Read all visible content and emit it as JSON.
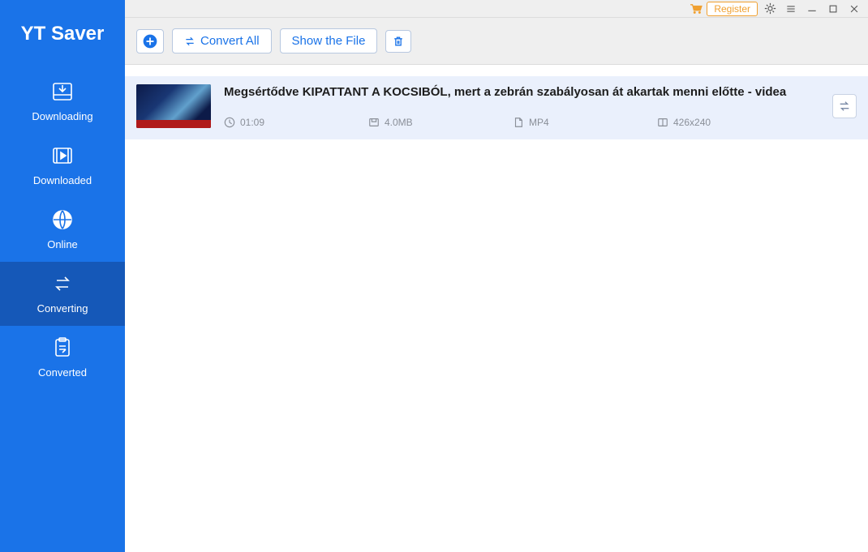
{
  "app": {
    "title": "YT Saver"
  },
  "sidebar": {
    "items": [
      {
        "label": "Downloading"
      },
      {
        "label": "Downloaded"
      },
      {
        "label": "Online"
      },
      {
        "label": "Converting"
      },
      {
        "label": "Converted"
      }
    ]
  },
  "titlebar": {
    "register": "Register"
  },
  "toolbar": {
    "convert_all": "Convert All",
    "show_file": "Show the File"
  },
  "items": [
    {
      "title": "Megsértődve KIPATTANT A KOCSIBÓL, mert a zebrán szabályosan át akartak menni előtte - videa",
      "duration": "01:09",
      "size": "4.0MB",
      "format": "MP4",
      "resolution": "426x240"
    }
  ]
}
